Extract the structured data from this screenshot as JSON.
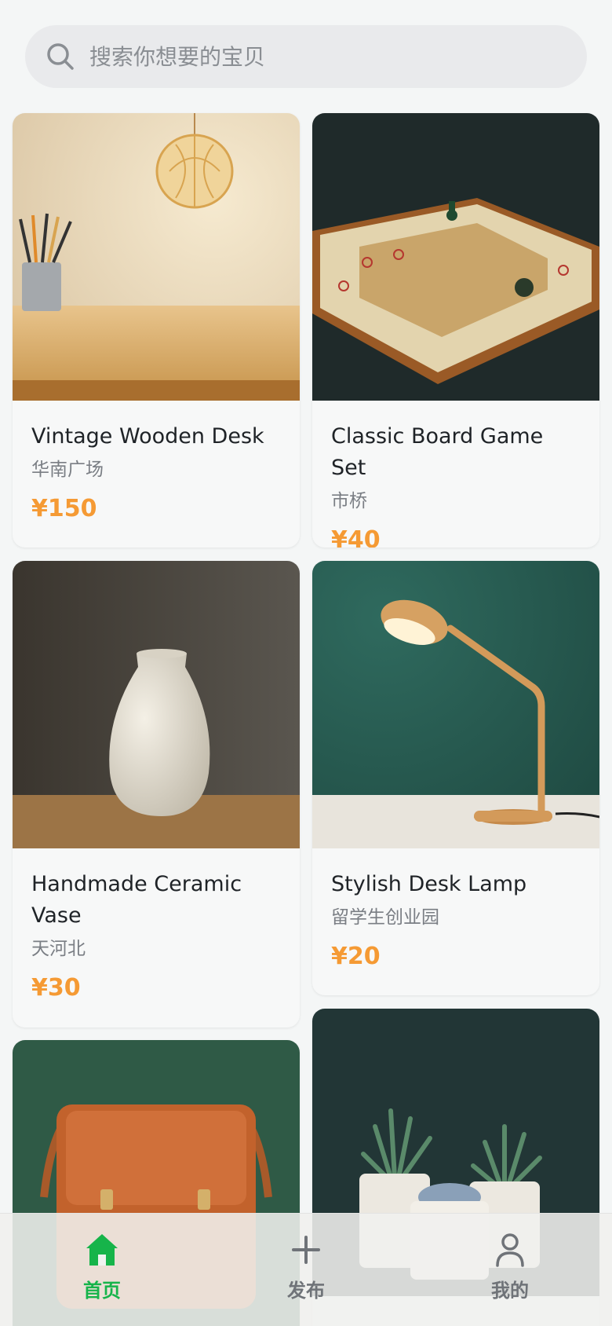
{
  "search": {
    "placeholder": "搜索你想要的宝贝"
  },
  "products": [
    {
      "title": "Vintage Wooden Desk",
      "location": "华南广场",
      "price": "¥150"
    },
    {
      "title": "Classic Board Game Set",
      "location": "市桥",
      "price": "¥40"
    },
    {
      "title": "Handmade Ceramic Vase",
      "location": "天河北",
      "price": "¥30"
    },
    {
      "title": "Stylish Desk Lamp",
      "location": "留学生创业园",
      "price": "¥20"
    },
    {
      "title": "",
      "location": "",
      "price": ""
    },
    {
      "title": "",
      "location": "",
      "price": ""
    }
  ],
  "bottom_nav": {
    "items": [
      {
        "label": "首页",
        "icon": "home-icon",
        "active": true
      },
      {
        "label": "发布",
        "icon": "plus-icon",
        "active": false
      },
      {
        "label": "我的",
        "icon": "user-icon",
        "active": false
      }
    ]
  },
  "colors": {
    "accent_green": "#16b44a",
    "price_orange": "#f59a34",
    "background": "#f4f6f6"
  }
}
